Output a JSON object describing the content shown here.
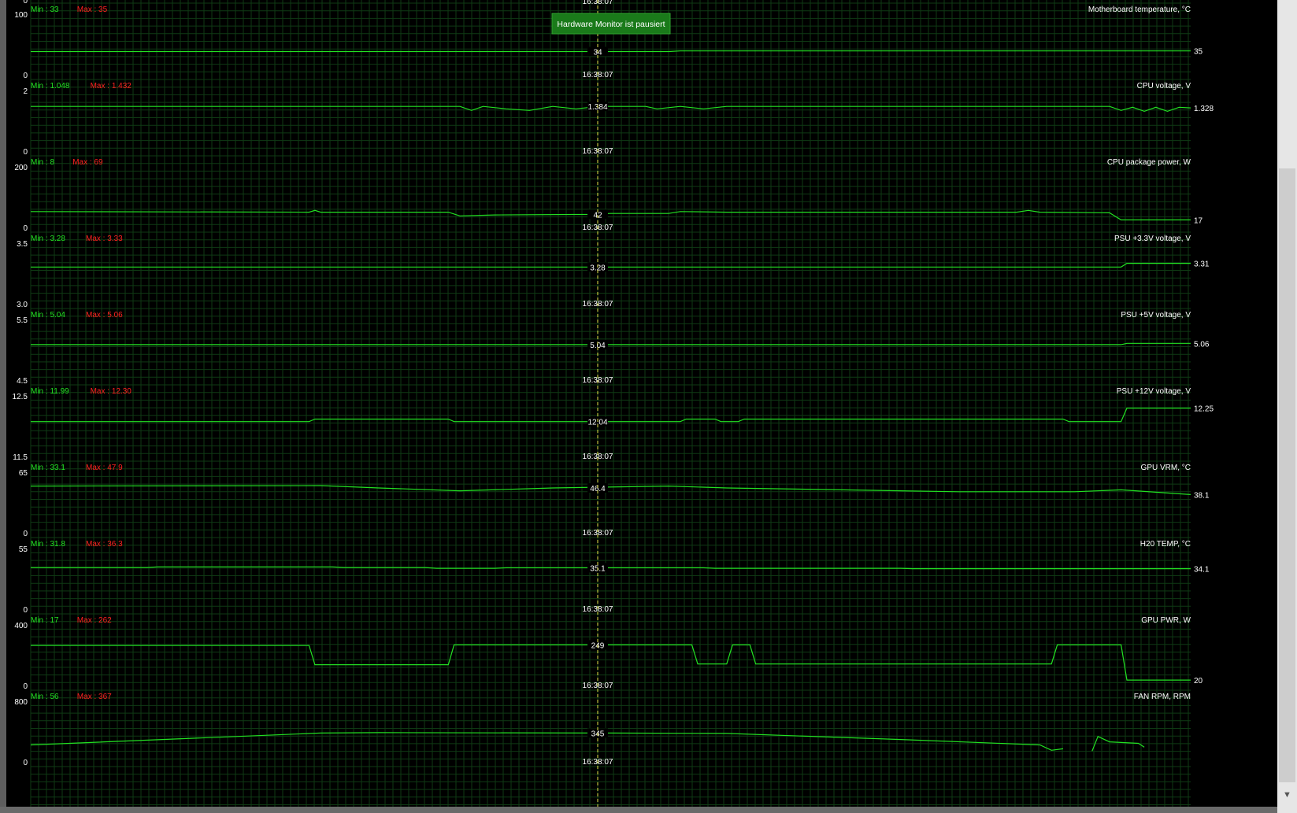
{
  "window": {
    "paused_label": "Hardware Monitor ist pausiert",
    "cursor_time": "16:38:07"
  },
  "colors": {
    "background": "#000000",
    "grid": "#0f3a14",
    "line": "#22e022",
    "text": "#ffffff",
    "min_text": "#22e022",
    "max_text": "#ff2020",
    "cursor": "#e6e64a",
    "pause_badge": "#1a7a1a"
  },
  "panels": [
    {
      "title": "Motherboard temperature, °C",
      "min_label": "Min : 33",
      "max_label": "Max : 35",
      "y_top": "100",
      "y_bottom": "0",
      "top_axis": "0",
      "cursor_value": "34",
      "current_value": "35",
      "range": [
        0,
        100
      ],
      "series": [
        [
          0,
          34
        ],
        [
          0.55,
          34
        ],
        [
          0.56,
          35
        ],
        [
          1,
          35
        ]
      ]
    },
    {
      "title": "CPU voltage, V",
      "min_label": "Min : 1.048",
      "max_label": "Max : 1.432",
      "y_top": "2",
      "y_bottom": "0",
      "cursor_value": "1.384",
      "current_value": "1.328",
      "range": [
        0,
        2
      ],
      "series": [
        [
          0,
          1.38
        ],
        [
          0.37,
          1.38
        ],
        [
          0.38,
          1.25
        ],
        [
          0.39,
          1.38
        ],
        [
          0.41,
          1.3
        ],
        [
          0.43,
          1.25
        ],
        [
          0.45,
          1.38
        ],
        [
          0.47,
          1.3
        ],
        [
          0.49,
          1.38
        ],
        [
          0.53,
          1.38
        ],
        [
          0.54,
          1.3
        ],
        [
          0.56,
          1.38
        ],
        [
          0.58,
          1.3
        ],
        [
          0.6,
          1.38
        ],
        [
          0.93,
          1.38
        ],
        [
          0.94,
          1.25
        ],
        [
          0.95,
          1.35
        ],
        [
          0.96,
          1.22
        ],
        [
          0.97,
          1.35
        ],
        [
          0.98,
          1.22
        ],
        [
          0.99,
          1.35
        ],
        [
          1,
          1.33
        ]
      ]
    },
    {
      "title": "CPU package power, W",
      "min_label": "Min : 8",
      "max_label": "Max : 69",
      "y_top": "200",
      "y_bottom": "0",
      "cursor_value": "42",
      "current_value": "17",
      "range": [
        0,
        200
      ],
      "series": [
        [
          0,
          44
        ],
        [
          0.24,
          42
        ],
        [
          0.245,
          48
        ],
        [
          0.25,
          42
        ],
        [
          0.36,
          42
        ],
        [
          0.37,
          30
        ],
        [
          0.4,
          33
        ],
        [
          0.48,
          35
        ],
        [
          0.5,
          38
        ],
        [
          0.55,
          38
        ],
        [
          0.56,
          44
        ],
        [
          0.6,
          42
        ],
        [
          0.85,
          42
        ],
        [
          0.86,
          48
        ],
        [
          0.87,
          42
        ],
        [
          0.93,
          40
        ],
        [
          0.94,
          17
        ],
        [
          1,
          17
        ]
      ]
    },
    {
      "title": "PSU +3.3V voltage, V",
      "min_label": "Min : 3.28",
      "max_label": "Max : 3.33",
      "y_top": "3.5",
      "y_bottom": "3.0",
      "cursor_value": "3.28",
      "current_value": "3.31",
      "range": [
        3.0,
        3.5
      ],
      "series": [
        [
          0,
          3.28
        ],
        [
          0.94,
          3.28
        ],
        [
          0.945,
          3.31
        ],
        [
          1,
          3.31
        ]
      ]
    },
    {
      "title": "PSU +5V voltage, V",
      "min_label": "Min : 5.04",
      "max_label": "Max : 5.06",
      "y_top": "5.5",
      "y_bottom": "4.5",
      "cursor_value": "5.04",
      "current_value": "5.06",
      "range": [
        4.5,
        5.5
      ],
      "series": [
        [
          0,
          5.04
        ],
        [
          0.94,
          5.04
        ],
        [
          0.945,
          5.06
        ],
        [
          1,
          5.06
        ]
      ]
    },
    {
      "title": "PSU +12V voltage, V",
      "min_label": "Min : 11.99",
      "max_label": "Max : 12.30",
      "y_top": "12.5",
      "y_bottom": "11.5",
      "cursor_value": "12.04",
      "current_value": "12.25",
      "range": [
        11.5,
        12.5
      ],
      "series": [
        [
          0,
          12.03
        ],
        [
          0.24,
          12.03
        ],
        [
          0.245,
          12.07
        ],
        [
          0.36,
          12.07
        ],
        [
          0.365,
          12.03
        ],
        [
          0.56,
          12.03
        ],
        [
          0.565,
          12.07
        ],
        [
          0.59,
          12.07
        ],
        [
          0.595,
          12.03
        ],
        [
          0.61,
          12.03
        ],
        [
          0.615,
          12.07
        ],
        [
          0.89,
          12.07
        ],
        [
          0.895,
          12.03
        ],
        [
          0.94,
          12.03
        ],
        [
          0.945,
          12.25
        ],
        [
          1,
          12.25
        ]
      ]
    },
    {
      "title": "GPU VRM, °C",
      "min_label": "Min : 33.1",
      "max_label": "Max : 47.9",
      "y_top": "65",
      "y_bottom": "0",
      "cursor_value": "46.4",
      "current_value": "38.1",
      "range": [
        0,
        65
      ],
      "series": [
        [
          0,
          47
        ],
        [
          0.25,
          47.5
        ],
        [
          0.3,
          45
        ],
        [
          0.37,
          42
        ],
        [
          0.45,
          45
        ],
        [
          0.55,
          47
        ],
        [
          0.6,
          45
        ],
        [
          0.7,
          43
        ],
        [
          0.8,
          41
        ],
        [
          0.9,
          41
        ],
        [
          0.94,
          43
        ],
        [
          1,
          38
        ]
      ]
    },
    {
      "title": "H20 TEMP, °C",
      "min_label": "Min : 31.8",
      "max_label": "Max : 36.3",
      "y_top": "55",
      "y_bottom": "0",
      "cursor_value": "35.1",
      "current_value": "34.1",
      "range": [
        0,
        55
      ],
      "series": [
        [
          0,
          35.2
        ],
        [
          0.1,
          35.2
        ],
        [
          0.11,
          35.8
        ],
        [
          0.26,
          35.8
        ],
        [
          0.27,
          35.2
        ],
        [
          0.34,
          35.2
        ],
        [
          0.35,
          34.5
        ],
        [
          0.4,
          34.5
        ],
        [
          0.41,
          35
        ],
        [
          0.58,
          35
        ],
        [
          0.59,
          34.5
        ],
        [
          0.75,
          34.5
        ],
        [
          0.76,
          34.1
        ],
        [
          1,
          34.1
        ]
      ]
    },
    {
      "title": "GPU PWR, W",
      "min_label": "Min : 17",
      "max_label": "Max : 262",
      "y_top": "400",
      "y_bottom": "0",
      "cursor_value": "249",
      "current_value": "20",
      "range": [
        0,
        400
      ],
      "series": [
        [
          0,
          245
        ],
        [
          0.24,
          245
        ],
        [
          0.245,
          120
        ],
        [
          0.36,
          120
        ],
        [
          0.365,
          249
        ],
        [
          0.57,
          249
        ],
        [
          0.575,
          125
        ],
        [
          0.6,
          125
        ],
        [
          0.605,
          249
        ],
        [
          0.62,
          249
        ],
        [
          0.625,
          125
        ],
        [
          0.88,
          125
        ],
        [
          0.885,
          249
        ],
        [
          0.94,
          249
        ],
        [
          0.945,
          20
        ],
        [
          1,
          20
        ]
      ]
    },
    {
      "title": "FAN RPM, RPM",
      "min_label": "Min : 56",
      "max_label": "Max : 367",
      "y_top": "800",
      "y_bottom": "0",
      "cursor_value": "345",
      "current_value": "",
      "range": [
        0,
        800
      ],
      "series": [
        [
          0,
          190
        ],
        [
          0.25,
          345
        ],
        [
          0.3,
          350
        ],
        [
          0.5,
          345
        ],
        [
          0.6,
          340
        ],
        [
          0.75,
          260
        ],
        [
          0.87,
          190
        ],
        [
          0.88,
          120
        ],
        [
          0.89,
          140
        ]
      ],
      "series2": [
        [
          0.915,
          110
        ],
        [
          0.92,
          300
        ],
        [
          0.93,
          230
        ],
        [
          0.955,
          210
        ],
        [
          0.96,
          160
        ]
      ]
    }
  ]
}
